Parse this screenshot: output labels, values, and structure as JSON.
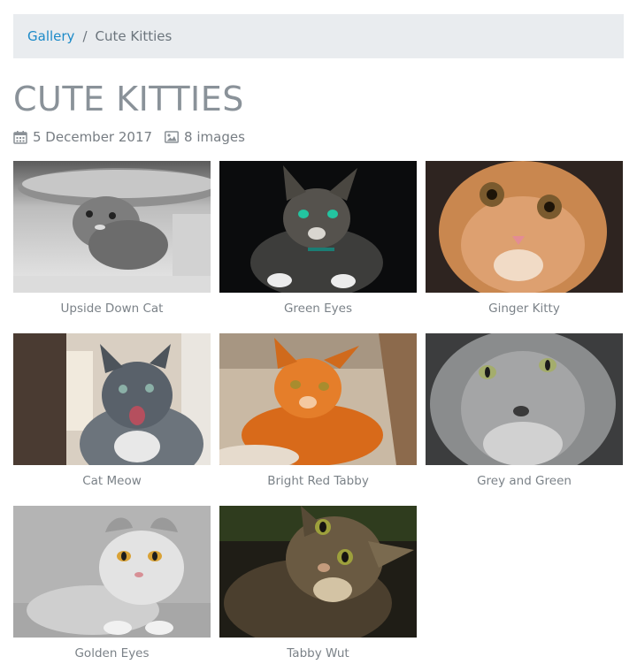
{
  "breadcrumb": {
    "items": [
      {
        "label": "Gallery"
      },
      {
        "label": "Cute Kitties"
      }
    ],
    "separator": "/"
  },
  "page": {
    "title": "CUTE KITTIES",
    "date": "5 December 2017",
    "image_count": "8 images"
  },
  "icons": {
    "date": "calendar-icon",
    "images": "image-icon"
  },
  "gallery": {
    "items": [
      {
        "caption": "Upside Down Cat"
      },
      {
        "caption": "Green Eyes"
      },
      {
        "caption": "Ginger Kitty"
      },
      {
        "caption": "Cat Meow"
      },
      {
        "caption": "Bright Red Tabby"
      },
      {
        "caption": "Grey and Green"
      },
      {
        "caption": "Golden Eyes"
      },
      {
        "caption": "Tabby Wut"
      }
    ]
  },
  "colors": {
    "link": "#1c8ac8",
    "breadcrumb_bg": "#e9ecef",
    "title": "#8a9299",
    "caption": "#7b8288"
  }
}
